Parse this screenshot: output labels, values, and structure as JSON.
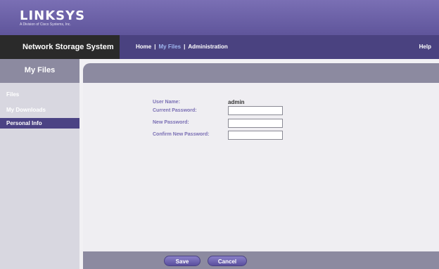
{
  "brand": {
    "logo_text": "LINKSYS",
    "logo_subtext": "A Division of Cisco Systems, Inc."
  },
  "nav": {
    "system_title": "Network Storage System",
    "links": [
      "Home",
      "My Files",
      "Administration"
    ],
    "separator": "|",
    "help": "Help"
  },
  "sidebar": {
    "title": "My Files",
    "items": [
      {
        "label": "Files"
      },
      {
        "label": "My Downloads"
      },
      {
        "label": "Personal Info"
      }
    ]
  },
  "form": {
    "username_label": "User Name:",
    "username_value": "admin",
    "current_password_label": "Current Password:",
    "new_password_label": "New Password:",
    "confirm_password_label": "Confirm New Password:",
    "current_password_value": "",
    "new_password_value": "",
    "confirm_password_value": ""
  },
  "buttons": {
    "save": "Save",
    "cancel": "Cancel"
  },
  "colors": {
    "brand": "#6e62a8",
    "nav": "#4a4280",
    "active_link": "#9fb8f0",
    "panel_grey": "#8c8aa0"
  }
}
